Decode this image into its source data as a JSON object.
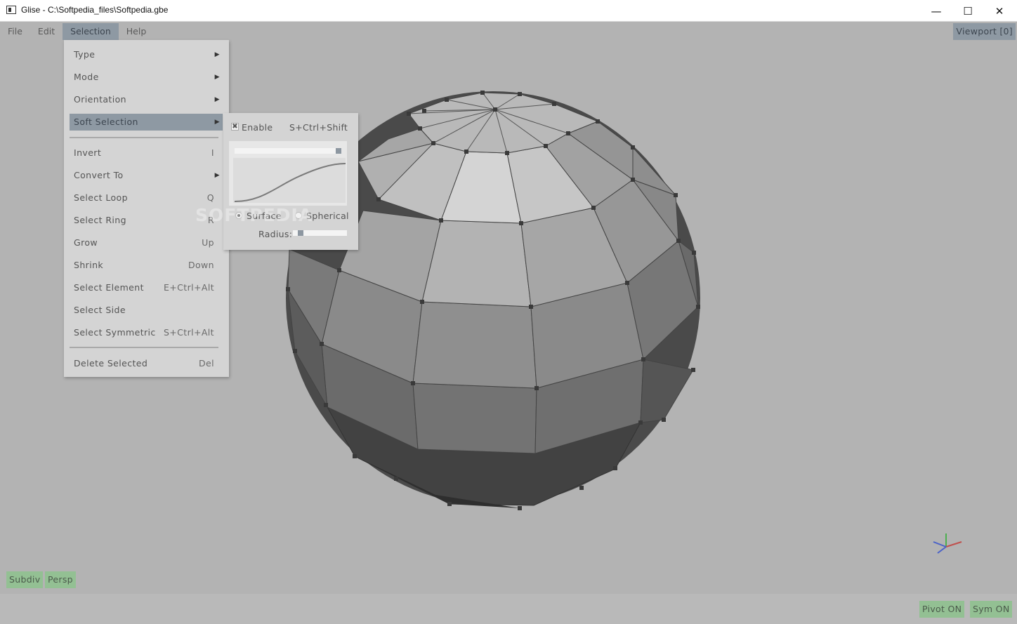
{
  "window": {
    "title": "Glise - C:\\Softpedia_files\\Softpedia.gbe",
    "minimize_glyph": "—",
    "maximize_glyph": "☐",
    "close_glyph": "✕"
  },
  "menubar": {
    "items": [
      {
        "label": "File"
      },
      {
        "label": "Edit"
      },
      {
        "label": "Selection"
      },
      {
        "label": "Help"
      }
    ]
  },
  "viewport_label": "Viewport [0]",
  "selection_menu": {
    "items": [
      {
        "label": "Type",
        "shortcut": "",
        "submenu": true
      },
      {
        "label": "Mode",
        "shortcut": "",
        "submenu": true
      },
      {
        "label": "Orientation",
        "shortcut": "",
        "submenu": true
      },
      {
        "label": "Soft Selection",
        "shortcut": "",
        "submenu": true
      },
      {
        "label": "Invert",
        "shortcut": "I",
        "submenu": false
      },
      {
        "label": "Convert To",
        "shortcut": "",
        "submenu": true
      },
      {
        "label": "Select Loop",
        "shortcut": "Q",
        "submenu": false
      },
      {
        "label": "Select Ring",
        "shortcut": "R",
        "submenu": false
      },
      {
        "label": "Grow",
        "shortcut": "Up",
        "submenu": false
      },
      {
        "label": "Shrink",
        "shortcut": "Down",
        "submenu": false
      },
      {
        "label": "Select Element",
        "shortcut": "E+Ctrl+Alt",
        "submenu": false
      },
      {
        "label": "Select Side",
        "shortcut": "",
        "submenu": false
      },
      {
        "label": "Select Symmetric",
        "shortcut": "S+Ctrl+Alt",
        "submenu": false
      },
      {
        "label": "Delete Selected",
        "shortcut": "Del",
        "submenu": false
      }
    ]
  },
  "soft_selection": {
    "enable_label": "Enable",
    "enable_shortcut": "S+Ctrl+Shift",
    "enabled": true,
    "falloff_level": 1.0,
    "surface_label": "Surface",
    "spherical_label": "Spherical",
    "radius_label": "Radius:",
    "radius_level": 0.05
  },
  "bottom_buttons": {
    "subdiv": "Subdiv",
    "persp": "Persp",
    "pivot": "Pivot ON",
    "sym": "Sym ON"
  },
  "watermark": "SOFTPEDIA",
  "colors": {
    "menu_highlight": "#8e99a3",
    "toggle_button": "#93c093",
    "viewport_bg": "#b3b3b3"
  }
}
